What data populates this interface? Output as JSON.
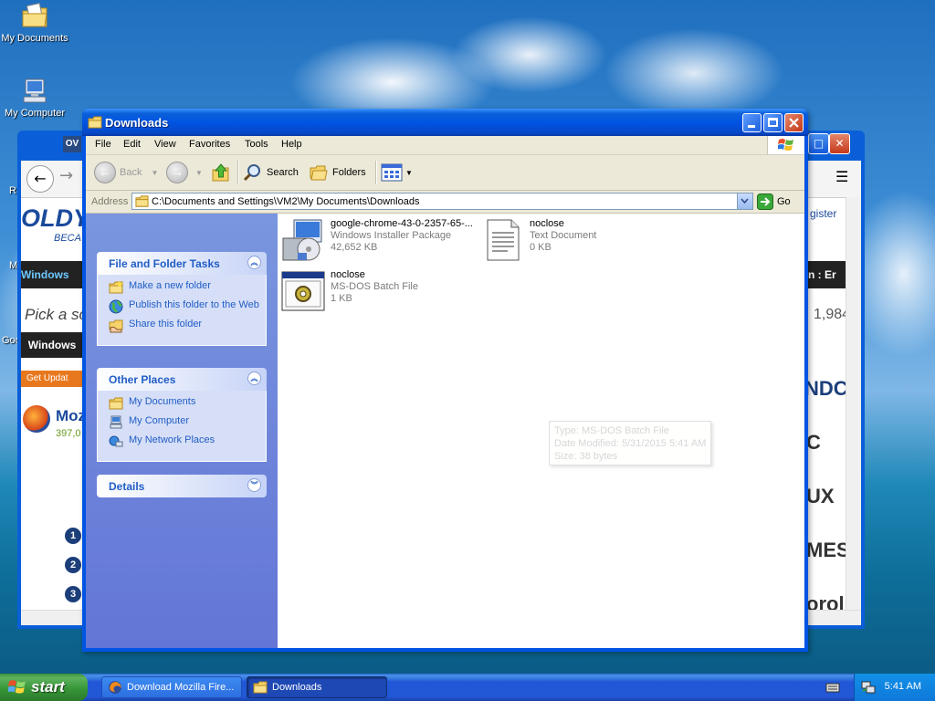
{
  "desktop": {
    "icons": [
      {
        "label": "My Documents",
        "icon": "my-documents-folder-icon"
      },
      {
        "label": "My Computer",
        "icon": "my-computer-icon"
      }
    ]
  },
  "browser_bg": {
    "tab_fragment": "OV",
    "logo_fragment": "OLDY",
    "tagline_fragment": "BECA",
    "register_fragment": "gister",
    "nav_fragment": "Windows",
    "nav_right_fragment": "n  :  Er",
    "pick_fragment": "Pick a sc",
    "count_fragment": "1,984",
    "windows_btn": "Windows",
    "get_updates": "Get Updat",
    "moz_fragment": "Moz",
    "moz_count": "397,0",
    "big_letters": [
      "NDC",
      "C",
      "UX",
      "MES",
      "orol"
    ],
    "numbers": [
      "1",
      "2",
      "3"
    ],
    "left_fragments": [
      "R",
      "M",
      "Goo"
    ]
  },
  "explorer": {
    "title": "Downloads",
    "menu": [
      "File",
      "Edit",
      "View",
      "Favorites",
      "Tools",
      "Help"
    ],
    "toolbar": {
      "back_label": "Back",
      "search_label": "Search",
      "folders_label": "Folders"
    },
    "address": {
      "label": "Address",
      "path": "C:\\Documents and Settings\\VM2\\My Documents\\Downloads",
      "go_label": "Go"
    },
    "tasks_panel": {
      "title": "File and Folder Tasks",
      "items": [
        "Make a new folder",
        "Publish this folder to the Web",
        "Share this folder"
      ]
    },
    "places_panel": {
      "title": "Other Places",
      "items": [
        "My Documents",
        "My Computer",
        "My Network Places"
      ]
    },
    "details_panel": {
      "title": "Details"
    },
    "files": [
      {
        "name": "google-chrome-43-0-2357-65-...",
        "type": "Windows Installer Package",
        "size": "42,652 KB",
        "icon": "installer-package-icon"
      },
      {
        "name": "noclose",
        "type": "Text Document",
        "size": "0 KB",
        "icon": "text-document-icon"
      },
      {
        "name": "noclose",
        "type": "MS-DOS Batch File",
        "size": "1 KB",
        "icon": "batch-file-icon"
      }
    ],
    "tooltip": {
      "line1": "Type: MS-DOS Batch File",
      "line2": "Date Modified: 5/31/2015 5:41 AM",
      "line3": "Size: 38 bytes"
    }
  },
  "taskbar": {
    "start_label": "start",
    "tasks": [
      {
        "label": "Download Mozilla Fire...",
        "active": false
      },
      {
        "label": "Downloads",
        "active": true
      }
    ],
    "clock": "5:41 AM"
  }
}
